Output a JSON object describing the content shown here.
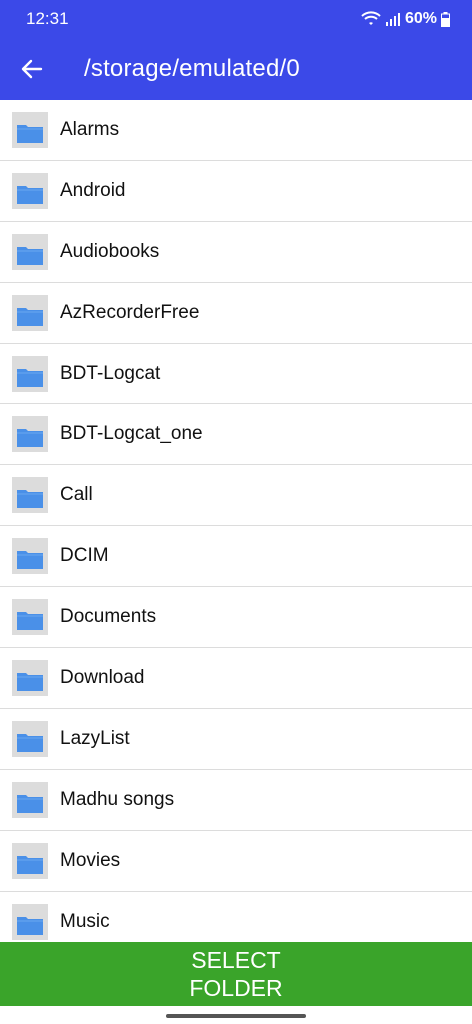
{
  "status_bar": {
    "time": "12:31",
    "battery": "60%"
  },
  "app_bar": {
    "title": "/storage/emulated/0",
    "back_icon": "arrow-left-icon"
  },
  "folders": [
    {
      "name": "Alarms"
    },
    {
      "name": "Android"
    },
    {
      "name": "Audiobooks"
    },
    {
      "name": "AzRecorderFree"
    },
    {
      "name": "BDT-Logcat"
    },
    {
      "name": "BDT-Logcat_one"
    },
    {
      "name": "Call"
    },
    {
      "name": "DCIM"
    },
    {
      "name": "Documents"
    },
    {
      "name": "Download"
    },
    {
      "name": "LazyList"
    },
    {
      "name": "Madhu songs"
    },
    {
      "name": "Movies"
    },
    {
      "name": "Music"
    }
  ],
  "select_button": {
    "label": "SELECT FOLDER"
  },
  "colors": {
    "app_bar": "#3b49e8",
    "select_button": "#3aa42a",
    "folder_icon": "#4a90e8"
  }
}
